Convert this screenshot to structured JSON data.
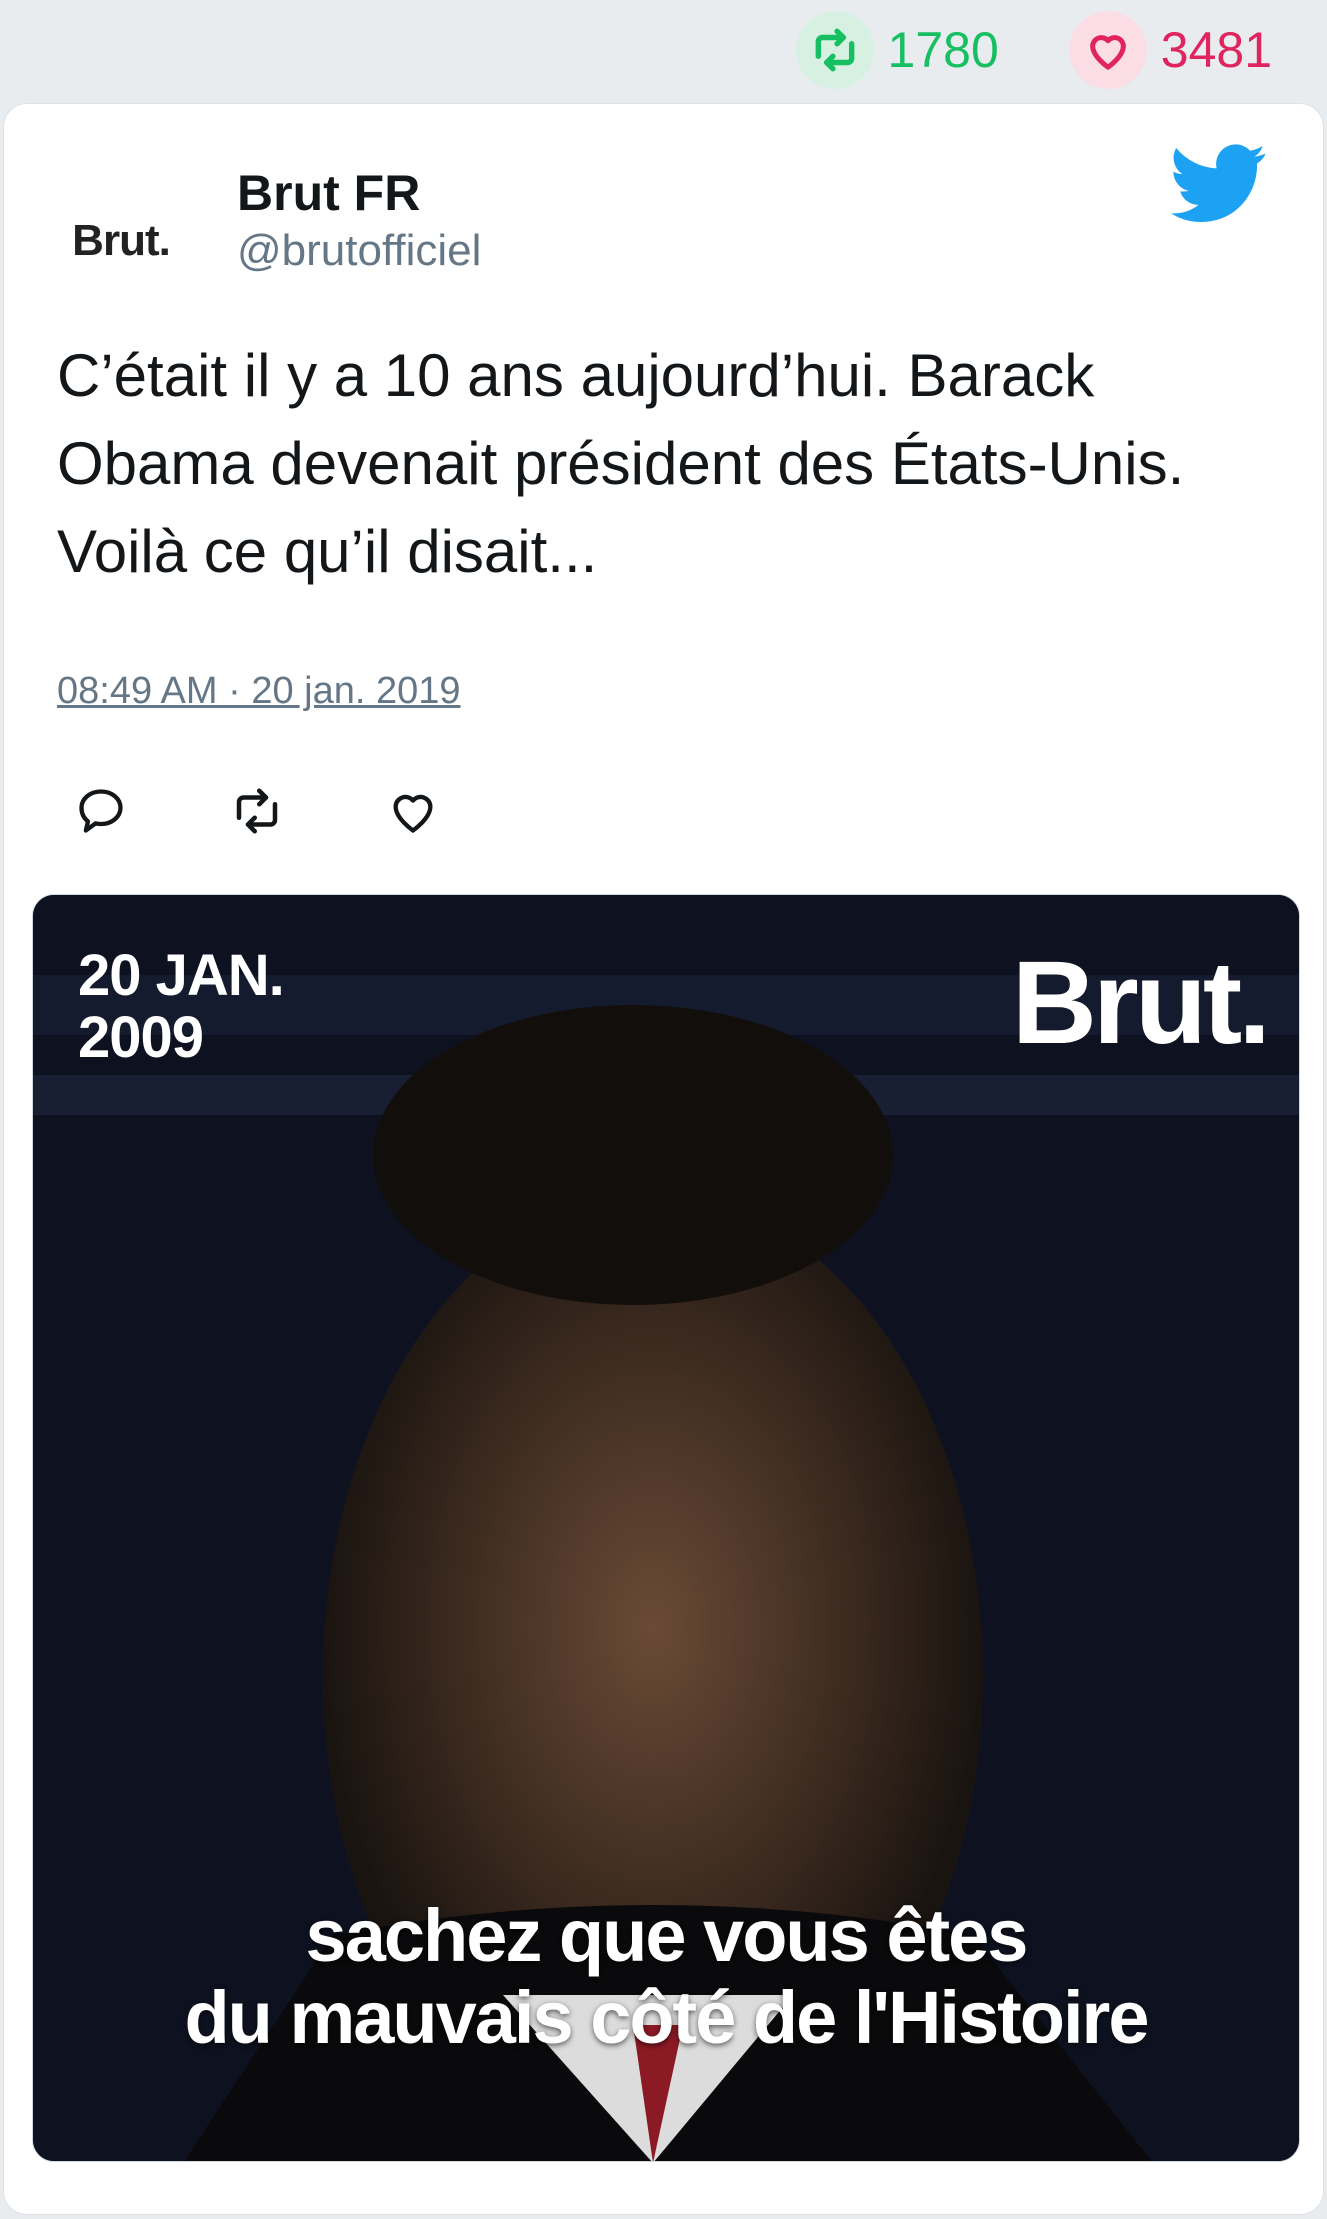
{
  "stats": {
    "retweet_count": "1780",
    "like_count": "3481",
    "retweet_color": "#17bf63",
    "like_color": "#e0245e"
  },
  "author": {
    "avatar_text": "Brut.",
    "name": "Brut FR",
    "handle": "@brutofficiel"
  },
  "tweet": {
    "text": "C’était il y a 10 ans aujourd’hui. Barack Obama devenait président des États-Unis. Voilà ce qu’il disait...",
    "timestamp": "08:49 AM · 20 jan. 2019"
  },
  "actions": {
    "reply_icon": "reply-icon",
    "retweet_icon": "retweet-icon",
    "like_icon": "heart-icon"
  },
  "media": {
    "date_line1": "20 JAN.",
    "date_line2": "2009",
    "brand": "Brut.",
    "caption_line1": "sachez que vous êtes",
    "caption_line2": "du mauvais côté de l'Histoire"
  },
  "colors": {
    "twitter_blue": "#1da1f2",
    "text_primary": "#14171a",
    "text_secondary": "#657786"
  }
}
